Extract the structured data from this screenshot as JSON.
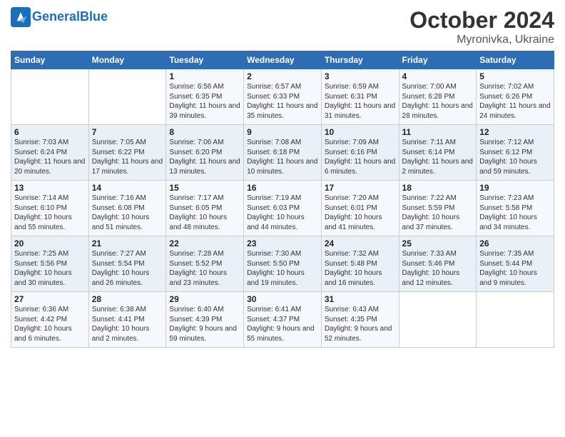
{
  "header": {
    "logo_general": "General",
    "logo_blue": "Blue",
    "month_title": "October 2024",
    "location": "Myronivka, Ukraine"
  },
  "days_of_week": [
    "Sunday",
    "Monday",
    "Tuesday",
    "Wednesday",
    "Thursday",
    "Friday",
    "Saturday"
  ],
  "weeks": [
    [
      {
        "day": "",
        "sunrise": "",
        "sunset": "",
        "daylight": ""
      },
      {
        "day": "",
        "sunrise": "",
        "sunset": "",
        "daylight": ""
      },
      {
        "day": "1",
        "sunrise": "Sunrise: 6:56 AM",
        "sunset": "Sunset: 6:35 PM",
        "daylight": "Daylight: 11 hours and 39 minutes."
      },
      {
        "day": "2",
        "sunrise": "Sunrise: 6:57 AM",
        "sunset": "Sunset: 6:33 PM",
        "daylight": "Daylight: 11 hours and 35 minutes."
      },
      {
        "day": "3",
        "sunrise": "Sunrise: 6:59 AM",
        "sunset": "Sunset: 6:31 PM",
        "daylight": "Daylight: 11 hours and 31 minutes."
      },
      {
        "day": "4",
        "sunrise": "Sunrise: 7:00 AM",
        "sunset": "Sunset: 6:28 PM",
        "daylight": "Daylight: 11 hours and 28 minutes."
      },
      {
        "day": "5",
        "sunrise": "Sunrise: 7:02 AM",
        "sunset": "Sunset: 6:26 PM",
        "daylight": "Daylight: 11 hours and 24 minutes."
      }
    ],
    [
      {
        "day": "6",
        "sunrise": "Sunrise: 7:03 AM",
        "sunset": "Sunset: 6:24 PM",
        "daylight": "Daylight: 11 hours and 20 minutes."
      },
      {
        "day": "7",
        "sunrise": "Sunrise: 7:05 AM",
        "sunset": "Sunset: 6:22 PM",
        "daylight": "Daylight: 11 hours and 17 minutes."
      },
      {
        "day": "8",
        "sunrise": "Sunrise: 7:06 AM",
        "sunset": "Sunset: 6:20 PM",
        "daylight": "Daylight: 11 hours and 13 minutes."
      },
      {
        "day": "9",
        "sunrise": "Sunrise: 7:08 AM",
        "sunset": "Sunset: 6:18 PM",
        "daylight": "Daylight: 11 hours and 10 minutes."
      },
      {
        "day": "10",
        "sunrise": "Sunrise: 7:09 AM",
        "sunset": "Sunset: 6:16 PM",
        "daylight": "Daylight: 11 hours and 6 minutes."
      },
      {
        "day": "11",
        "sunrise": "Sunrise: 7:11 AM",
        "sunset": "Sunset: 6:14 PM",
        "daylight": "Daylight: 11 hours and 2 minutes."
      },
      {
        "day": "12",
        "sunrise": "Sunrise: 7:12 AM",
        "sunset": "Sunset: 6:12 PM",
        "daylight": "Daylight: 10 hours and 59 minutes."
      }
    ],
    [
      {
        "day": "13",
        "sunrise": "Sunrise: 7:14 AM",
        "sunset": "Sunset: 6:10 PM",
        "daylight": "Daylight: 10 hours and 55 minutes."
      },
      {
        "day": "14",
        "sunrise": "Sunrise: 7:16 AM",
        "sunset": "Sunset: 6:08 PM",
        "daylight": "Daylight: 10 hours and 51 minutes."
      },
      {
        "day": "15",
        "sunrise": "Sunrise: 7:17 AM",
        "sunset": "Sunset: 6:05 PM",
        "daylight": "Daylight: 10 hours and 48 minutes."
      },
      {
        "day": "16",
        "sunrise": "Sunrise: 7:19 AM",
        "sunset": "Sunset: 6:03 PM",
        "daylight": "Daylight: 10 hours and 44 minutes."
      },
      {
        "day": "17",
        "sunrise": "Sunrise: 7:20 AM",
        "sunset": "Sunset: 6:01 PM",
        "daylight": "Daylight: 10 hours and 41 minutes."
      },
      {
        "day": "18",
        "sunrise": "Sunrise: 7:22 AM",
        "sunset": "Sunset: 5:59 PM",
        "daylight": "Daylight: 10 hours and 37 minutes."
      },
      {
        "day": "19",
        "sunrise": "Sunrise: 7:23 AM",
        "sunset": "Sunset: 5:58 PM",
        "daylight": "Daylight: 10 hours and 34 minutes."
      }
    ],
    [
      {
        "day": "20",
        "sunrise": "Sunrise: 7:25 AM",
        "sunset": "Sunset: 5:56 PM",
        "daylight": "Daylight: 10 hours and 30 minutes."
      },
      {
        "day": "21",
        "sunrise": "Sunrise: 7:27 AM",
        "sunset": "Sunset: 5:54 PM",
        "daylight": "Daylight: 10 hours and 26 minutes."
      },
      {
        "day": "22",
        "sunrise": "Sunrise: 7:28 AM",
        "sunset": "Sunset: 5:52 PM",
        "daylight": "Daylight: 10 hours and 23 minutes."
      },
      {
        "day": "23",
        "sunrise": "Sunrise: 7:30 AM",
        "sunset": "Sunset: 5:50 PM",
        "daylight": "Daylight: 10 hours and 19 minutes."
      },
      {
        "day": "24",
        "sunrise": "Sunrise: 7:32 AM",
        "sunset": "Sunset: 5:48 PM",
        "daylight": "Daylight: 10 hours and 16 minutes."
      },
      {
        "day": "25",
        "sunrise": "Sunrise: 7:33 AM",
        "sunset": "Sunset: 5:46 PM",
        "daylight": "Daylight: 10 hours and 12 minutes."
      },
      {
        "day": "26",
        "sunrise": "Sunrise: 7:35 AM",
        "sunset": "Sunset: 5:44 PM",
        "daylight": "Daylight: 10 hours and 9 minutes."
      }
    ],
    [
      {
        "day": "27",
        "sunrise": "Sunrise: 6:36 AM",
        "sunset": "Sunset: 4:42 PM",
        "daylight": "Daylight: 10 hours and 6 minutes."
      },
      {
        "day": "28",
        "sunrise": "Sunrise: 6:38 AM",
        "sunset": "Sunset: 4:41 PM",
        "daylight": "Daylight: 10 hours and 2 minutes."
      },
      {
        "day": "29",
        "sunrise": "Sunrise: 6:40 AM",
        "sunset": "Sunset: 4:39 PM",
        "daylight": "Daylight: 9 hours and 59 minutes."
      },
      {
        "day": "30",
        "sunrise": "Sunrise: 6:41 AM",
        "sunset": "Sunset: 4:37 PM",
        "daylight": "Daylight: 9 hours and 55 minutes."
      },
      {
        "day": "31",
        "sunrise": "Sunrise: 6:43 AM",
        "sunset": "Sunset: 4:35 PM",
        "daylight": "Daylight: 9 hours and 52 minutes."
      },
      {
        "day": "",
        "sunrise": "",
        "sunset": "",
        "daylight": ""
      },
      {
        "day": "",
        "sunrise": "",
        "sunset": "",
        "daylight": ""
      }
    ]
  ]
}
